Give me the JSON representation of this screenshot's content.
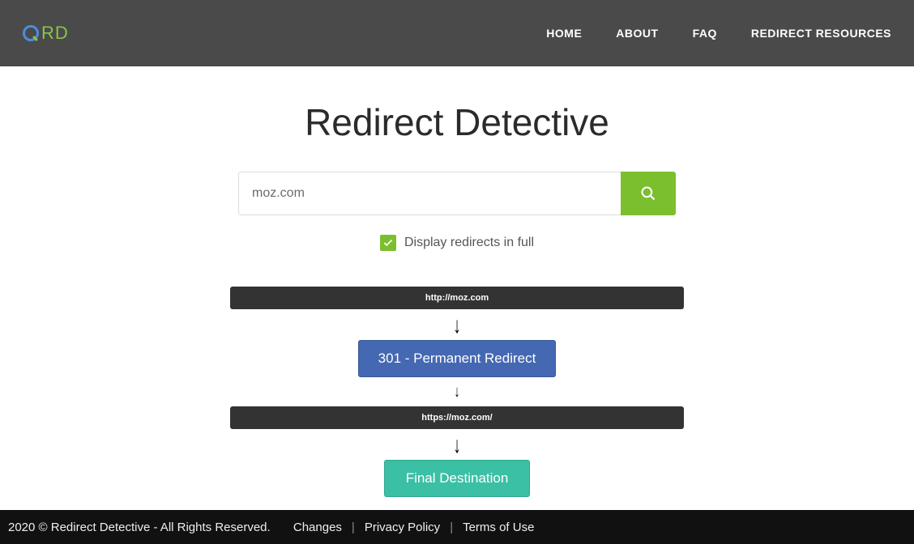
{
  "header": {
    "nav": [
      "HOME",
      "ABOUT",
      "FAQ",
      "REDIRECT RESOURCES"
    ]
  },
  "page": {
    "title": "Redirect Detective"
  },
  "search": {
    "value": "moz.com",
    "display_full_label": "Display redirects in full"
  },
  "trace": {
    "items": [
      {
        "kind": "url",
        "text": "http://moz.com"
      },
      {
        "kind": "arrow_big"
      },
      {
        "kind": "status",
        "text": "301 - Permanent Redirect"
      },
      {
        "kind": "arrow_small"
      },
      {
        "kind": "url",
        "text": "https://moz.com/"
      },
      {
        "kind": "arrow_big"
      },
      {
        "kind": "final",
        "text": "Final Destination"
      }
    ]
  },
  "footer": {
    "copyright": "2020 © Redirect Detective - All Rights Reserved.",
    "links": [
      "Changes",
      "Privacy Policy",
      "Terms of Use"
    ]
  }
}
